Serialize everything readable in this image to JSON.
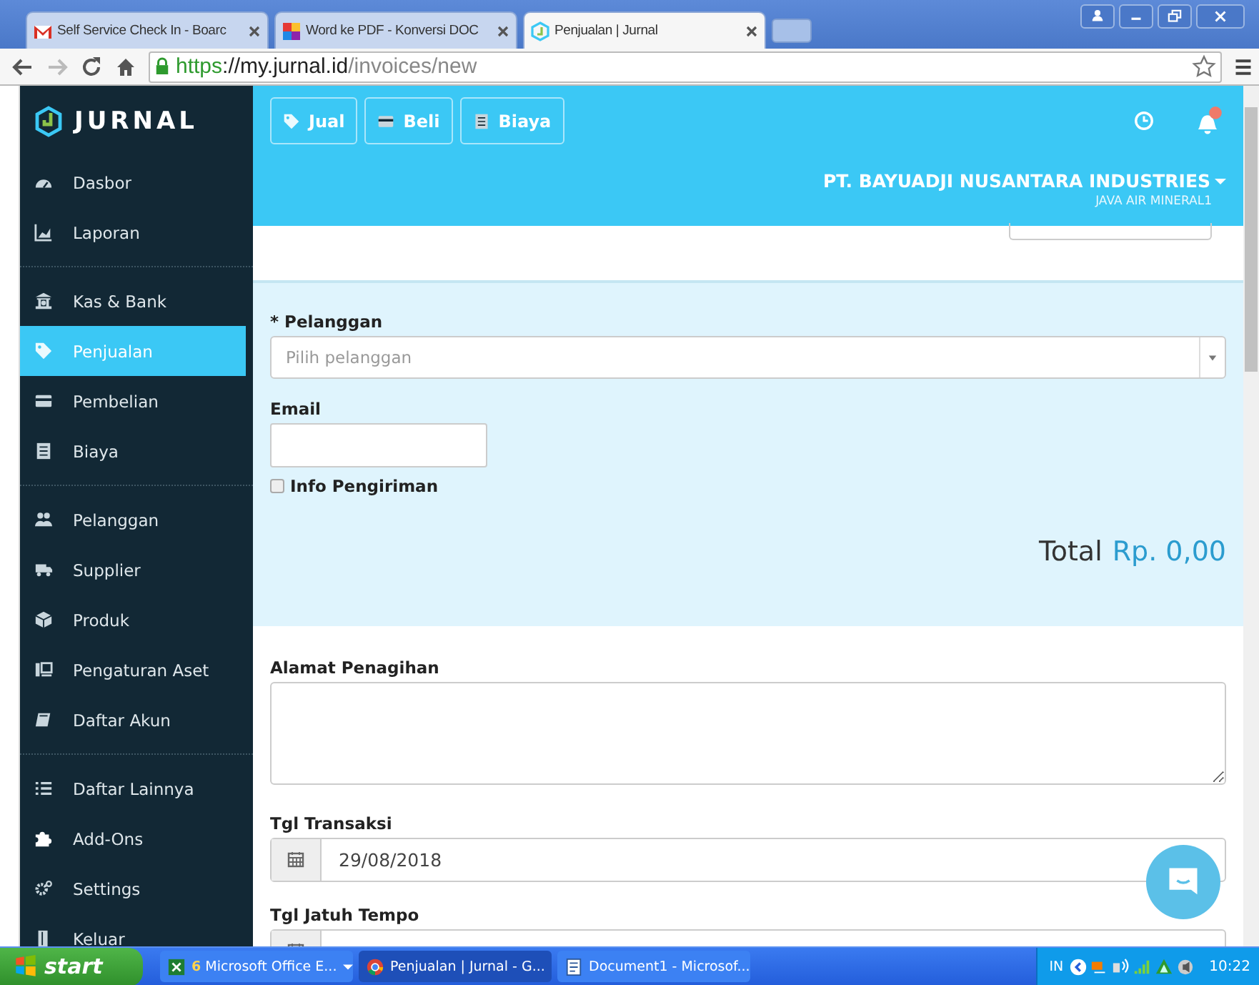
{
  "browser": {
    "tabs": [
      {
        "title": "Self Service Check In - Boarc",
        "kind": "mail",
        "selected": false
      },
      {
        "title": "Word ke PDF - Konversi DOC",
        "kind": "grid",
        "selected": false
      },
      {
        "title": "Penjualan | Jurnal",
        "kind": "jurnal",
        "selected": true
      }
    ],
    "url": {
      "scheme": "https",
      "host": "://my.jurnal.id",
      "path": "/invoices/new"
    }
  },
  "sidebar": {
    "logo": "JURNAL",
    "groups": [
      [
        {
          "label": "Dasbor",
          "kind": "gauge",
          "selected": false
        },
        {
          "label": "Laporan",
          "kind": "chart",
          "selected": false
        }
      ],
      [
        {
          "label": "Kas & Bank",
          "kind": "bank",
          "selected": false
        },
        {
          "label": "Penjualan",
          "kind": "tag",
          "selected": true
        },
        {
          "label": "Pembelian",
          "kind": "card",
          "selected": false
        },
        {
          "label": "Biaya",
          "kind": "receipt",
          "selected": false
        }
      ],
      [
        {
          "label": "Pelanggan",
          "kind": "people",
          "selected": false
        },
        {
          "label": "Supplier",
          "kind": "truck",
          "selected": false
        },
        {
          "label": "Produk",
          "kind": "cube",
          "selected": false
        },
        {
          "label": "Pengaturan Aset",
          "kind": "asset",
          "selected": false
        },
        {
          "label": "Daftar Akun",
          "kind": "book",
          "selected": false
        }
      ],
      [
        {
          "label": "Daftar Lainnya",
          "kind": "list",
          "selected": false
        },
        {
          "label": "Add-Ons",
          "kind": "puzzle",
          "selected": false
        },
        {
          "label": "Settings",
          "kind": "gear",
          "selected": false
        },
        {
          "label": "Keluar",
          "kind": "door",
          "selected": false
        }
      ]
    ]
  },
  "header": {
    "buttons": [
      {
        "label": "Jual",
        "kind": "tag"
      },
      {
        "label": "Beli",
        "kind": "card"
      },
      {
        "label": "Biaya",
        "kind": "receipt"
      }
    ],
    "company": "PT. BAYUADJI NUSANTARA INDUSTRIES",
    "company_sub": "JAVA AIR MINERAL1"
  },
  "form": {
    "customer": {
      "label": "* Pelanggan",
      "placeholder": "Pilih pelanggan"
    },
    "email": {
      "label": "Email"
    },
    "shipping_info": {
      "label": "Info Pengiriman",
      "checked": false
    },
    "total": {
      "label": "Total",
      "amount": "Rp. 0,00"
    },
    "billing_address": {
      "label": "Alamat Penagihan"
    },
    "transaction_date": {
      "label": "Tgl Transaksi",
      "value": "29/08/2018"
    },
    "due_date": {
      "label": "Tgl Jatuh Tempo"
    }
  },
  "taskbar": {
    "start": "start",
    "tasks": [
      {
        "count": "6",
        "label": "Microsoft Office E...",
        "kind": "excel",
        "selected": false
      },
      {
        "label": "Penjualan | Jurnal - G...",
        "kind": "chrome",
        "selected": true
      },
      {
        "label": "Document1 - Microsof...",
        "kind": "word",
        "selected": false
      }
    ],
    "language": "IN",
    "time": "10:22"
  }
}
